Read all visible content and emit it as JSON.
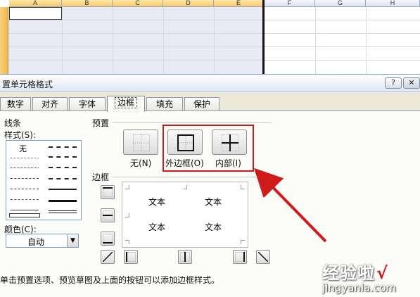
{
  "spreadsheet": {
    "columns": [
      "A",
      "B",
      "C",
      "D",
      "E",
      "F",
      "G",
      "H"
    ]
  },
  "dialog": {
    "title": "置单元格格式",
    "help_label": "?",
    "close_label": "✕",
    "tabs": [
      {
        "label": "数字"
      },
      {
        "label": "对齐"
      },
      {
        "label": "字体"
      },
      {
        "label": "边框"
      },
      {
        "label": "填充"
      },
      {
        "label": "保护"
      }
    ],
    "active_tab": "边框",
    "line": {
      "section_label": "线条",
      "style_label": "样式(S):",
      "none_label": "无",
      "color_label": "颜色(C):",
      "color_value": "自动"
    },
    "presets": {
      "section_label": "预置",
      "none_label": "无(N)",
      "outline_label": "外边框(O)",
      "inside_label": "内部(I)"
    },
    "border": {
      "section_label": "边框",
      "preview_texts": [
        "文本",
        "文本",
        "文本",
        "文本"
      ]
    },
    "hint": "单击预置选项、预览草图及上面的按钮可以添加边框样式。"
  },
  "watermark": {
    "main": "经验啦",
    "check": "√",
    "sub": "jingyanla.com"
  },
  "colors": {
    "highlight": "#d11a1a",
    "dialog_bg": "#ece9d8",
    "panel_bg": "#fbfbf8",
    "selection": "#eaeaf7"
  }
}
